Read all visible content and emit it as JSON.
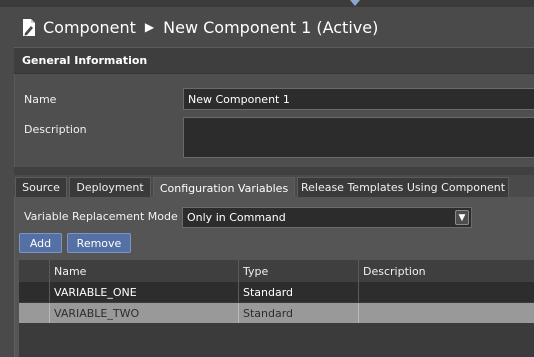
{
  "header": {
    "breadcrumb_root": "Component",
    "breadcrumb_separator": "▶",
    "breadcrumb_current": "New Component 1 (Active)",
    "icon": "document-edit-icon"
  },
  "general": {
    "section_title": "General Information",
    "name_label": "Name",
    "name_value": "New Component 1",
    "description_label": "Description",
    "description_value": ""
  },
  "tabs": [
    {
      "label": "Source",
      "active": false
    },
    {
      "label": "Deployment",
      "active": false
    },
    {
      "label": "Configuration Variables",
      "active": true
    },
    {
      "label": "Release Templates Using Component",
      "active": false
    }
  ],
  "config": {
    "mode_label": "Variable Replacement Mode",
    "mode_value": "Only in Command",
    "add_label": "Add",
    "remove_label": "Remove",
    "columns": [
      "Name",
      "Type",
      "Description"
    ],
    "rows": [
      {
        "name": "VARIABLE_ONE",
        "type": "Standard",
        "description": ""
      },
      {
        "name": "VARIABLE_TWO",
        "type": "Standard",
        "description": ""
      }
    ]
  },
  "colors": {
    "background": "#4a4a4a",
    "button": "#5470a5",
    "selected_row": "#999999"
  }
}
